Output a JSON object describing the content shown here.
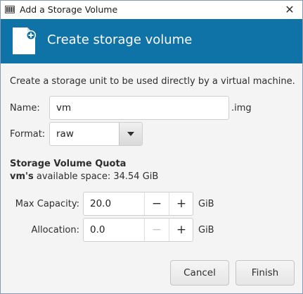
{
  "window": {
    "title": "Add a Storage Volume",
    "close_label": "✕"
  },
  "banner": {
    "title": "Create storage volume",
    "icon": "new-file-icon",
    "color": "#0f73a8"
  },
  "form": {
    "description": "Create a storage unit to be used directly by a virtual machine.",
    "name_label": "Name:",
    "name_value": "vm",
    "name_suffix": ".img",
    "format_label": "Format:",
    "format_value": "raw"
  },
  "quota": {
    "title": "Storage Volume Quota",
    "pool_name": "vm's",
    "available_text": " available space: 34.54 GiB",
    "max_capacity_label": "Max Capacity:",
    "max_capacity_value": "20.0",
    "max_capacity_unit": "GiB",
    "allocation_label": "Allocation:",
    "allocation_value": "0.0",
    "allocation_unit": "GiB",
    "minus": "−",
    "plus": "+"
  },
  "buttons": {
    "cancel": "Cancel",
    "finish": "Finish"
  }
}
